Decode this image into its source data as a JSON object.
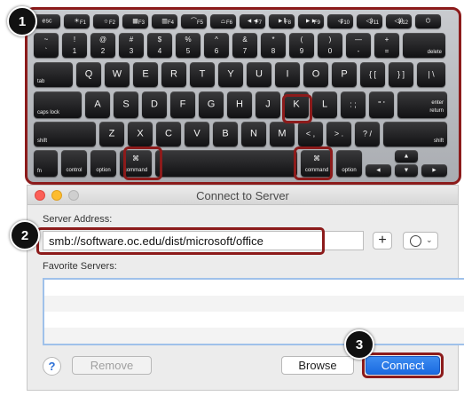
{
  "keyboard": {
    "fn_row": [
      "esc",
      "F1",
      "F2",
      "F3",
      "F4",
      "F5",
      "F6",
      "F7",
      "F8",
      "F9",
      "F10",
      "F11",
      "F12",
      ""
    ],
    "number_row": [
      {
        "top": "~",
        "bottom": "`"
      },
      {
        "top": "!",
        "bottom": "1"
      },
      {
        "top": "@",
        "bottom": "2"
      },
      {
        "top": "#",
        "bottom": "3"
      },
      {
        "top": "$",
        "bottom": "4"
      },
      {
        "top": "%",
        "bottom": "5"
      },
      {
        "top": "^",
        "bottom": "6"
      },
      {
        "top": "&",
        "bottom": "7"
      },
      {
        "top": "*",
        "bottom": "8"
      },
      {
        "top": "(",
        "bottom": "9"
      },
      {
        "top": ")",
        "bottom": "0"
      },
      {
        "top": "—",
        "bottom": "-"
      },
      {
        "top": "+",
        "bottom": "="
      },
      {
        "top": "",
        "bottom": "delete"
      }
    ],
    "tab_row": [
      "tab",
      "Q",
      "W",
      "E",
      "R",
      "T",
      "Y",
      "U",
      "I",
      "O",
      "P",
      "{ [",
      "} ]",
      "| \\"
    ],
    "caps_row": [
      "caps lock",
      "A",
      "S",
      "D",
      "F",
      "G",
      "H",
      "J",
      "K",
      "L",
      ": ;",
      "\" '",
      "enter return"
    ],
    "shift_row": [
      "shift",
      "Z",
      "X",
      "C",
      "V",
      "B",
      "N",
      "M",
      "< ,",
      "> .",
      "? /",
      "shift"
    ],
    "bottom_row": {
      "fn": "fn",
      "control": "control",
      "option": "option",
      "command_symbol": "⌘",
      "command": "command",
      "arrow_left": "◄",
      "arrow_up": "▲",
      "arrow_down": "▼",
      "arrow_right": "►"
    }
  },
  "callouts": [
    "1",
    "2",
    "3"
  ],
  "dialog": {
    "title": "Connect to Server",
    "server_address_label": "Server Address:",
    "server_address_value": "smb://software.oc.edu/dist/microsoft/office",
    "add_button": "+",
    "favorite_servers_label": "Favorite Servers:",
    "help_button": "?",
    "remove_button": "Remove",
    "browse_button": "Browse",
    "connect_button": "Connect"
  },
  "colors": {
    "highlight": "#8c1b1b",
    "connect_blue": "#1a73e8",
    "close": "#fc5f57",
    "minimize": "#fdbc2e",
    "zoom": "#cfcfcf"
  }
}
